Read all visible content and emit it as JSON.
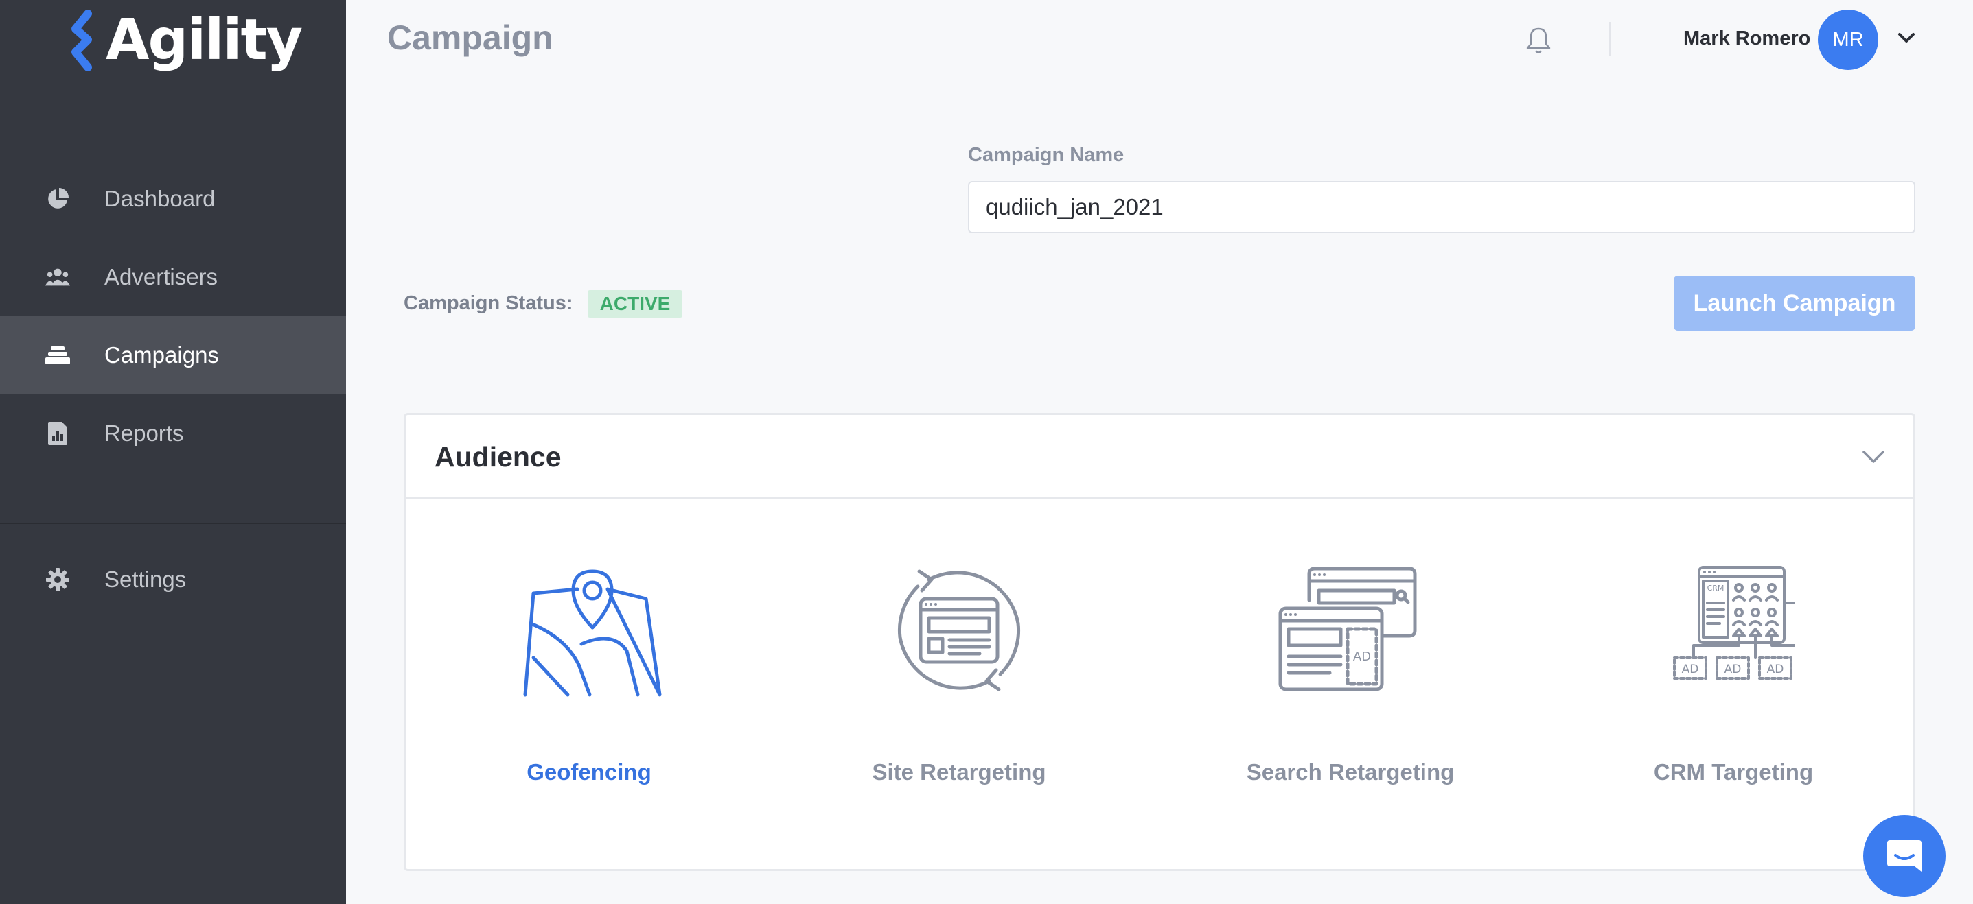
{
  "app": {
    "name": "Agility"
  },
  "sidebar": {
    "items": [
      {
        "label": "Dashboard",
        "icon": "pie-chart-icon"
      },
      {
        "label": "Advertisers",
        "icon": "users-icon"
      },
      {
        "label": "Campaigns",
        "icon": "stack-icon",
        "active": true
      },
      {
        "label": "Reports",
        "icon": "report-icon"
      }
    ],
    "settings": {
      "label": "Settings",
      "icon": "gear-icon"
    }
  },
  "header": {
    "title": "Campaign",
    "user": {
      "name": "Mark Romero",
      "initials": "MR"
    }
  },
  "form": {
    "campaign_name_label": "Campaign Name",
    "campaign_name_value": "qudiich_jan_2021",
    "status_label": "Campaign Status:",
    "status_value": "ACTIVE",
    "launch_label": "Launch Campaign"
  },
  "audience": {
    "title": "Audience",
    "options": [
      {
        "label": "Geofencing",
        "selected": true
      },
      {
        "label": "Site Retargeting"
      },
      {
        "label": "Search Retargeting"
      },
      {
        "label": "CRM Targeting"
      }
    ],
    "ad_label": "AD",
    "crm_label": "CRM"
  },
  "colors": {
    "sidebar": "#353840",
    "accent": "#3b7cf0",
    "status_active": "#3daa6b",
    "icon_gray": "#8a91a0"
  }
}
